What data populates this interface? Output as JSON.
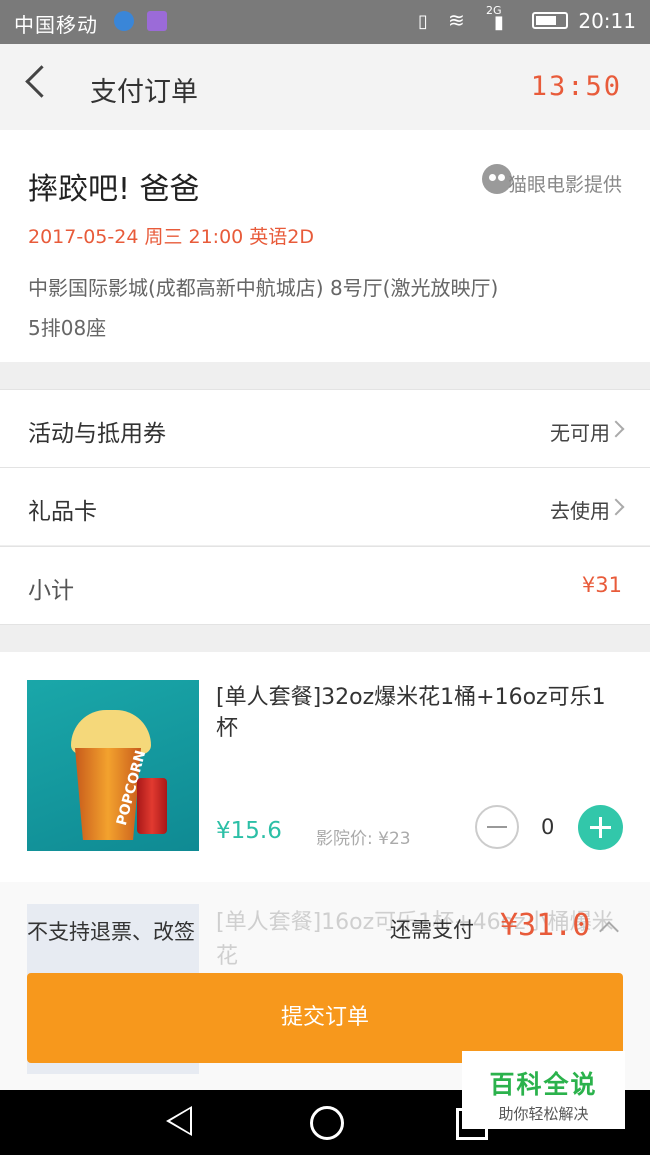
{
  "status_bar": {
    "carrier": "中国移动",
    "network": "2G",
    "time": "20:11"
  },
  "header": {
    "title": "支付订单",
    "countdown": "13:50"
  },
  "movie": {
    "name": "摔跤吧! 爸爸",
    "provider": "猫眼电影提供",
    "showtime": "2017-05-24 周三 21:00 英语2D",
    "cinema": "中影国际影城(成都高新中航城店) 8号厅(激光放映厅)",
    "seat": "5排08座"
  },
  "rows": {
    "coupon": {
      "label": "活动与抵用券",
      "value": "无可用"
    },
    "gift_card": {
      "label": "礼品卡",
      "value": "去使用"
    },
    "subtotal": {
      "label": "小计",
      "value": "¥31"
    }
  },
  "snack": {
    "name": "[单人套餐]32oz爆米花1桶+16oz可乐1杯",
    "bucket_text": "POPCORN",
    "price": "¥15.6",
    "cinema_price": "影院价: ¥23",
    "quantity": "0"
  },
  "bottom": {
    "ghost_item": "[单人套餐]16oz可乐1杯+46oz小桶爆米花",
    "no_refund": "不支持退票、改签",
    "need_pay_label": "还需支付",
    "total": "¥31.0",
    "submit_label": "提交订单"
  },
  "watermark": {
    "title": "百科全说",
    "subtitle": "助你轻松解决"
  },
  "colors": {
    "accent": "#e85b3a",
    "submit": "#f7981c",
    "teal": "#32c7aa"
  }
}
